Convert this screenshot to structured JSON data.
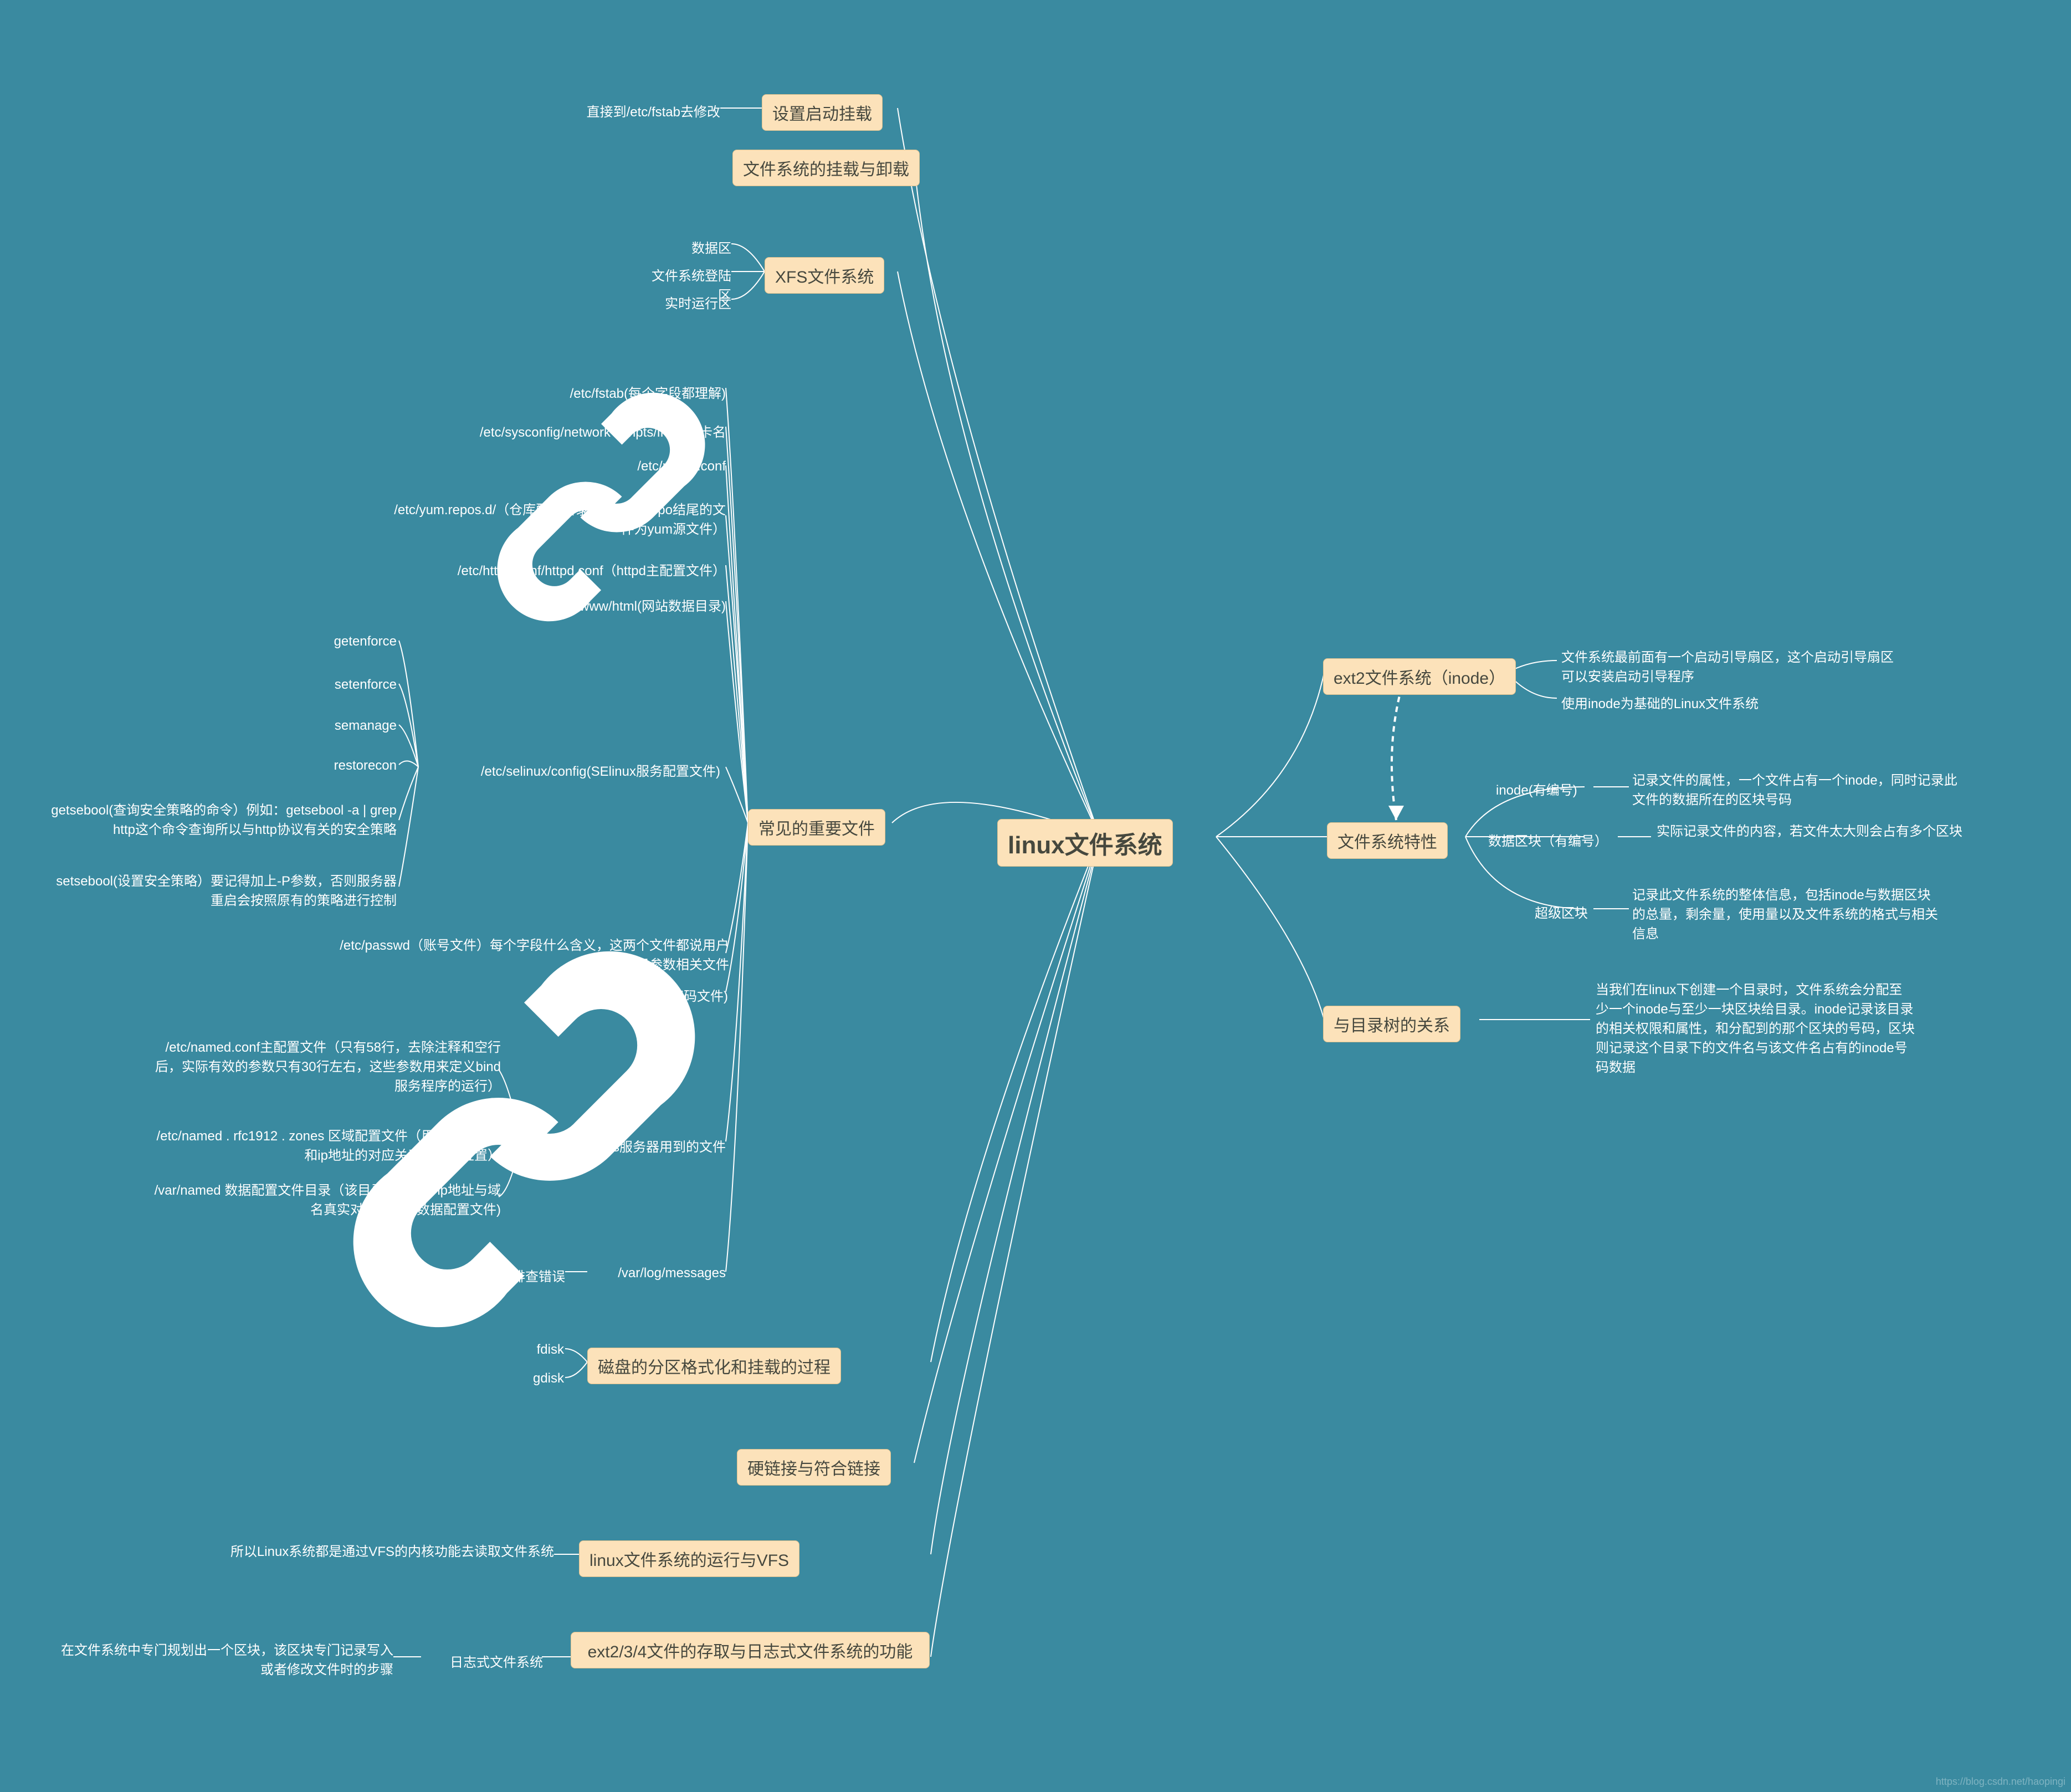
{
  "center": "linux文件系统",
  "nodes": {
    "bootMount": {
      "label": "设置启动挂载"
    },
    "mountUmount": {
      "label": "文件系统的挂载与卸载"
    },
    "xfs": {
      "label": "XFS文件系统"
    },
    "important": {
      "label": "常见的重要文件"
    },
    "partition": {
      "label": "磁盘的分区格式化和挂载的过程"
    },
    "link": {
      "label": "硬链接与符合链接"
    },
    "vfs": {
      "label": "linux文件系统的运行与VFS"
    },
    "journal": {
      "label": "ext2/3/4文件的存取与日志式文件系统的功能"
    },
    "ext2": {
      "label": "ext2文件系统（inode）"
    },
    "feat": {
      "label": "文件系统特性"
    },
    "dtree": {
      "label": "与目录树的关系"
    }
  },
  "left": {
    "bootMount_fstab": "直接到/etc/fstab去修改",
    "xfs_items": [
      "数据区",
      "文件系统登陆区",
      "实时运行区"
    ],
    "imp_items": [
      "/etc/fstab(每个字段都理解)",
      "/etc/sysconfig/network-scripts/ifcfg-网卡名",
      "/etc/resolv.conf",
      "/etc/yum.repos.d/（仓库配置目录，识别以.repo结尾的文件为yum源文件）",
      "/etc/httpd/conf/httpd.conf（httpd主配置文件）",
      "/var/www/html(网站数据目录)"
    ],
    "imp_selinux_label": "/etc/selinux/config(SElinux服务配置文件)",
    "imp_selinux": [
      "getenforce",
      "setenforce",
      "semanage",
      "restorecon",
      "getsebool(查询安全策略的命令）例如：getsebool -a | grep http这个命令查询所以与http协议有关的安全策略",
      "setsebool(设置安全策略）要记得加上-P参数，否则服务器重启会按照原有的策略进行控制"
    ],
    "imp_pass": [
      "/etc/passwd（账号文件）每个字段什么含义，这两个文件都说用户账号与密码参数相关文件",
      "/etc/shadow(密码文件)"
    ],
    "imp_dns_label": "配置dns服务器用到的文件",
    "imp_dns": [
      "/etc/named.conf主配置文件（只有58行，去除注释和空行后，实际有效的参数只有30行左右，这些参数用来定义bind服务程序的运行）",
      "/etc/named . rfc1912 . zones 区域配置文件（用来保存域名和ip地址的对应关系所在的位置）",
      "/var/named  数据配置文件目录（该目录用来保存ip地址与域名真实对应关系的数据配置文件)"
    ],
    "imp_log_label": "/var/log/messages",
    "imp_log_val": "日志文件，可以用于排查错误",
    "part_items": [
      "fdisk",
      "gdisk"
    ],
    "vfs_note": "所以Linux系统都是通过VFS的内核功能去读取文件系统",
    "jnl_mid": "日志式文件系统",
    "jnl_note": "在文件系统中专门规划出一个区块，该区块专门记录写入或者修改文件时的步骤"
  },
  "right": {
    "ext2_items": [
      "文件系统最前面有一个启动引导扇区，这个启动引导扇区可以安装启动引导程序",
      "使用inode为基础的Linux文件系统"
    ],
    "feat_items": [
      {
        "k": "inode(有编号)",
        "v": "记录文件的属性，一个文件占有一个inode，同时记录此文件的数据所在的区块号码"
      },
      {
        "k": "数据区块（有编号）",
        "v": "实际记录文件的内容，若文件太大则会占有多个区块"
      },
      {
        "k": "超级区块",
        "v": "记录此文件系统的整体信息，包括inode与数据区块的总量，剩余量，使用量以及文件系统的格式与相关信息"
      }
    ],
    "dtree_note": "当我们在linux下创建一个目录时，文件系统会分配至少一个inode与至少一块区块给目录。inode记录该目录的相关权限和属性，和分配到的那个区块的号码，区块则记录这个目录下的文件名与该文件名占有的inode号码数据"
  },
  "wm": "https://blog.csdn.net/haopingi"
}
